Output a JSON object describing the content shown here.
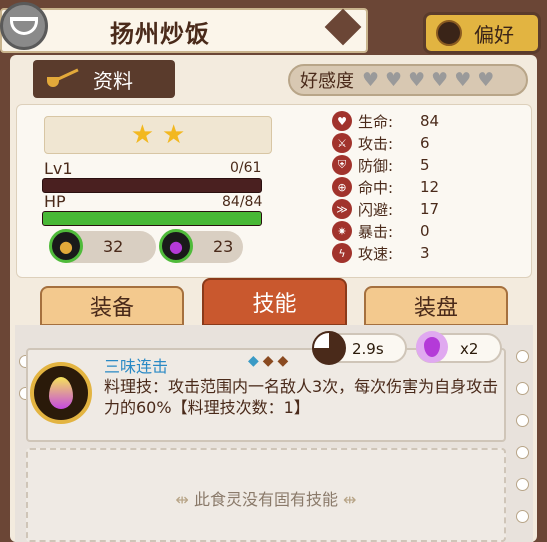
{
  "header": {
    "title": "扬州炒饭",
    "favorite_label": "偏好"
  },
  "info_tab": {
    "label": "资料"
  },
  "affinity": {
    "label": "好感度",
    "hearts_total": 6,
    "hearts_filled": 0
  },
  "card": {
    "stars": 2,
    "level_label": "Lv1",
    "exp_value": "0/61",
    "exp_fraction": 0.0,
    "hp_label": "HP",
    "hp_value": "84/84",
    "hp_fraction": 1.0,
    "resources": [
      {
        "icon": "food-pot-icon",
        "value": "32"
      },
      {
        "icon": "purple-gem-icon",
        "value": "23"
      }
    ]
  },
  "stats": [
    {
      "icon": "heart-icon",
      "name": "生命:",
      "value": "84"
    },
    {
      "icon": "sword-icon",
      "name": "攻击:",
      "value": "6"
    },
    {
      "icon": "shield-icon",
      "name": "防御:",
      "value": "5"
    },
    {
      "icon": "crosshair-icon",
      "name": "命中:",
      "value": "12"
    },
    {
      "icon": "dodge-icon",
      "name": "闪避:",
      "value": "17"
    },
    {
      "icon": "critical-icon",
      "name": "暴击:",
      "value": "0"
    },
    {
      "icon": "speed-icon",
      "name": "攻速:",
      "value": "3"
    }
  ],
  "tabs": [
    {
      "label": "装备",
      "active": false
    },
    {
      "label": "技能",
      "active": true
    },
    {
      "label": "装盘",
      "active": false
    }
  ],
  "skill": {
    "name": "三味连击",
    "cooldown": "2.9s",
    "energy": "x2",
    "description": "料理技：攻击范围内一名敌人3次，每次伤害为自身攻击力的60%【料理技次数：1】"
  },
  "innate": {
    "empty_text": "此食灵没有固有技能"
  },
  "colors": {
    "frame": "#6b4636",
    "accent": "#e2b441",
    "skill_name": "#2a8ac5",
    "active_tab": "#c9582e",
    "hp_bar": "#48b836"
  }
}
